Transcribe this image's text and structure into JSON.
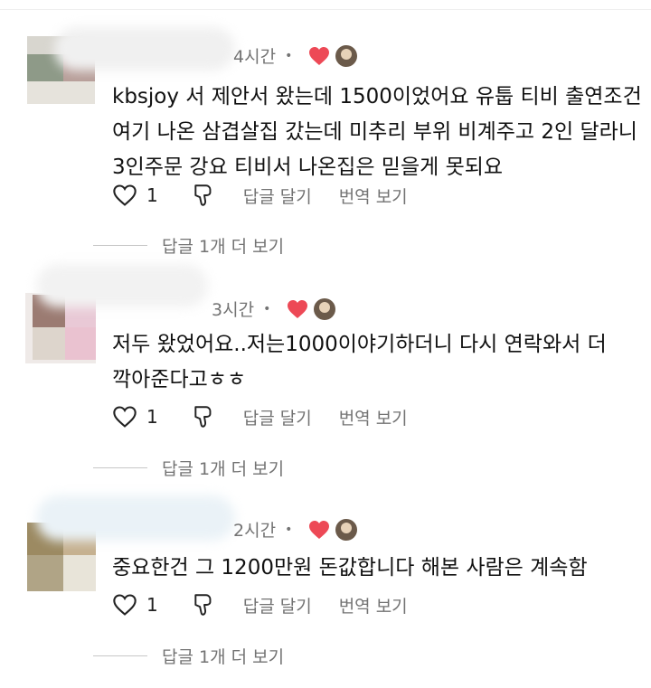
{
  "comments": [
    {
      "time": "4시간",
      "dot": "•",
      "text": "kbsjoy 서 제안서 왔는데 1500이었어요 유툽 티비 출연조건 여기 나온 삼겹살집 갔는데 미추리 부위 비계주고 2인 달라니 3인주문 강요 티비서 나온집은 믿을게 못되요",
      "likes": "1",
      "reply_label": "답글 달기",
      "translate_label": "번역 보기",
      "more_replies": "답글 1개 더 보기"
    },
    {
      "time": "3시간",
      "dot": "•",
      "text": "저두 왔었어요..저는1000이야기하더니 다시 연락와서 더 깍아준다고ㅎㅎ",
      "likes": "1",
      "reply_label": "답글 달기",
      "translate_label": "번역 보기",
      "more_replies": "답글 1개 더 보기"
    },
    {
      "time": "2시간",
      "dot": "•",
      "text": "중요한건 그 1200만원 돈값합니다 해본 사람은 계속함",
      "likes": "1",
      "reply_label": "답글 달기",
      "translate_label": "번역 보기",
      "more_replies": "답글 1개 더 보기"
    }
  ],
  "colors": {
    "heart": "#ed4956",
    "muted_text": "#737373",
    "body_text": "#111111"
  },
  "icons": [
    "heart-outline-icon",
    "thumbs-down-icon",
    "liked-by-author-heart-icon",
    "author-avatar-icon"
  ]
}
